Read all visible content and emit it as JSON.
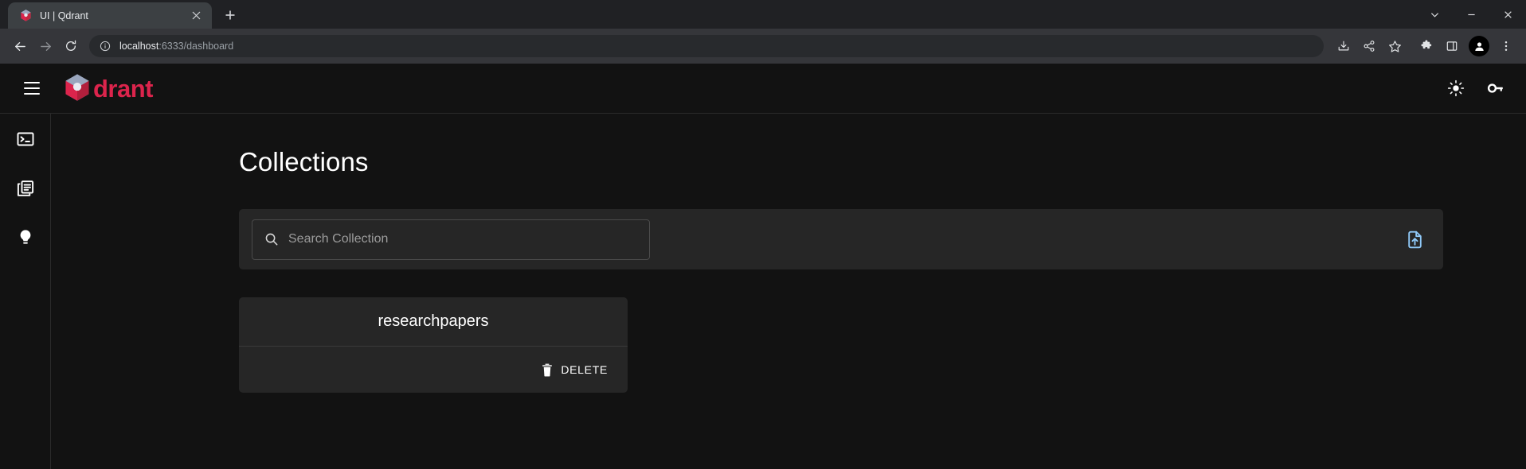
{
  "browser": {
    "tab": {
      "title": "UI | Qdrant",
      "favicon_icon": "qdrant-logo-icon",
      "close_icon": "close-icon"
    },
    "new_tab_icon": "plus-icon",
    "window_controls": [
      {
        "name": "tab-search",
        "icon": "chevron-down-icon",
        "glyph": "⌄"
      },
      {
        "name": "minimize",
        "icon": "minimize-icon",
        "glyph": "–"
      },
      {
        "name": "close",
        "icon": "close-icon",
        "glyph": "✕"
      }
    ],
    "nav": {
      "back_icon": "back-arrow-icon",
      "forward_icon": "forward-arrow-icon",
      "reload_icon": "reload-icon"
    },
    "omnibox": {
      "info_icon": "site-info-icon",
      "url_host": "localhost",
      "url_path": ":6333/dashboard",
      "url_full": "localhost:6333/dashboard"
    },
    "toolbar_right": [
      {
        "name": "install-app-button",
        "icon": "install-icon"
      },
      {
        "name": "share-button",
        "icon": "share-icon"
      },
      {
        "name": "bookmark-button",
        "icon": "star-icon"
      },
      {
        "name": "extensions-button",
        "icon": "puzzle-icon"
      },
      {
        "name": "side-panel-button",
        "icon": "side-panel-icon"
      },
      {
        "name": "profile-button",
        "icon": "person-icon"
      },
      {
        "name": "chrome-menu-button",
        "icon": "three-dots-icon"
      }
    ]
  },
  "app": {
    "header": {
      "menu_icon": "hamburger-menu-icon",
      "brand_word": "drant",
      "brand_logo_icon": "qdrant-cube-icon",
      "actions": [
        {
          "name": "theme-toggle",
          "icon": "sun-icon"
        },
        {
          "name": "api-key-button",
          "icon": "key-icon"
        }
      ]
    },
    "sidebar": {
      "items": [
        {
          "name": "sidebar-item-console",
          "icon": "terminal-icon"
        },
        {
          "name": "sidebar-item-collections",
          "icon": "collections-icon"
        },
        {
          "name": "sidebar-item-tutorial",
          "icon": "lightbulb-icon"
        }
      ]
    },
    "main": {
      "title": "Collections",
      "search": {
        "placeholder": "Search Collection",
        "value": "",
        "icon": "search-icon"
      },
      "upload": {
        "icon": "file-upload-icon",
        "color": "#90caf9"
      },
      "collections": [
        {
          "name": "researchpapers",
          "delete_label": "DELETE",
          "delete_icon": "trash-icon"
        }
      ]
    }
  },
  "colors": {
    "brand_red": "#dc244c",
    "app_bg": "#121212",
    "card_bg": "#262626",
    "accent_blue": "#90caf9"
  }
}
